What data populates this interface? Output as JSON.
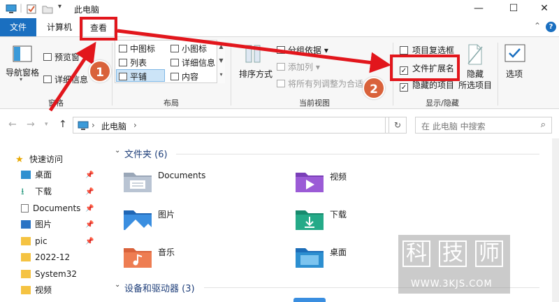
{
  "titlebar": {
    "title": "此电脑"
  },
  "tabs": {
    "file": "文件",
    "computer": "计算机",
    "view": "查看"
  },
  "ribbon": {
    "nav_pane": "导航窗格",
    "preview_pane": "预览窗",
    "details_pane": "详细信息",
    "pane_group": "窗格",
    "layout": {
      "medium_icons": "中图标",
      "small_icons": "小图标",
      "list": "列表",
      "details": "详细信息",
      "tiles": "平铺",
      "content": "内容"
    },
    "layout_group": "布局",
    "sort_by": "排序方式",
    "group_by": "分组依据",
    "add_column": "添加列",
    "fit_columns": "将所有列调整为合适",
    "current_view_group": "当前视图",
    "item_checkboxes": "项目复选框",
    "file_ext": "文件扩展名",
    "hidden_items": "隐藏的项目",
    "hide": "隐藏",
    "hide_selected": "所选项目",
    "options": "选项",
    "showhide_group": "显示/隐藏"
  },
  "address": {
    "path": "此电脑",
    "search_placeholder": "在 此电脑 中搜索"
  },
  "nav": [
    {
      "label": "快速访问",
      "icon": "star-icon"
    },
    {
      "label": "桌面",
      "icon": "desktop-icon"
    },
    {
      "label": "下载",
      "icon": "download-icon"
    },
    {
      "label": "Documents",
      "icon": "document-icon"
    },
    {
      "label": "图片",
      "icon": "picture-icon"
    },
    {
      "label": "pic",
      "icon": "folder-icon"
    },
    {
      "label": "2022-12",
      "icon": "folder-icon"
    },
    {
      "label": "System32",
      "icon": "folder-icon"
    },
    {
      "label": "视频",
      "icon": "folder-icon"
    }
  ],
  "content": {
    "folders_header": "文件夹 (6)",
    "folders": [
      "Documents",
      "视频",
      "图片",
      "下载",
      "音乐",
      "桌面"
    ],
    "drives_header": "设备和驱动器 (3)"
  },
  "annotations": {
    "badge1": "1",
    "badge2": "2"
  },
  "watermark": {
    "c1": "科",
    "c2": "技",
    "c3": "师",
    "url": "WWW.3KJS.COM"
  },
  "colors": {
    "accent": "#1a6fc0",
    "highlight": "#e2161c",
    "badge": "#d9623b"
  }
}
